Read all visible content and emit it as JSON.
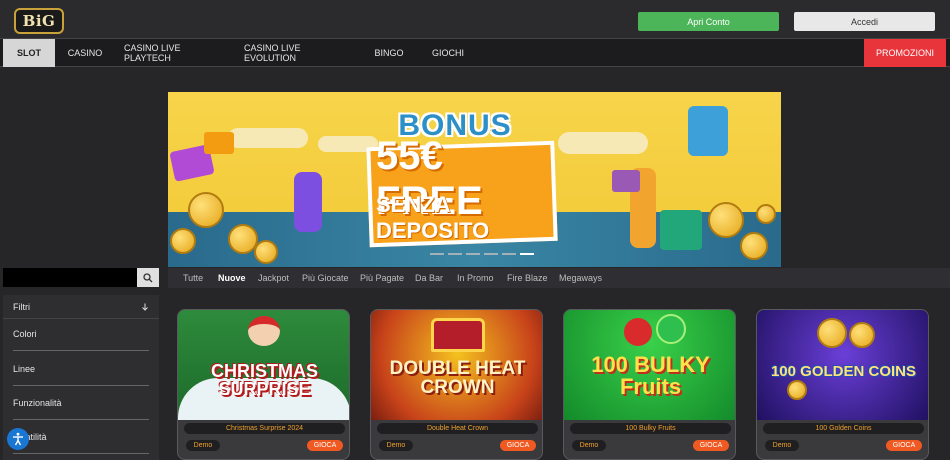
{
  "header": {
    "logo_text": "BiG",
    "open_account_label": "Apri Conto",
    "login_label": "Accedi"
  },
  "nav": {
    "items": [
      {
        "label": "SLOT"
      },
      {
        "label": "CASINO"
      },
      {
        "label": "CASINO LIVE PLAYTECH"
      },
      {
        "label": "CASINO LIVE EVOLUTION"
      },
      {
        "label": "BINGO"
      },
      {
        "label": "GIOCHI"
      }
    ],
    "promo_label": "PROMOZIONI"
  },
  "banner": {
    "headline": "BONUS",
    "amount": "55€ FREE",
    "subline": "SENZA DEPOSITO",
    "slides_total": 6,
    "active_slide": 6
  },
  "search": {
    "icon": "search-icon",
    "value": ""
  },
  "tabs": [
    {
      "label": "Tutte"
    },
    {
      "label": "Nuove"
    },
    {
      "label": "Jackpot"
    },
    {
      "label": "Più Giocate"
    },
    {
      "label": "Più Pagate"
    },
    {
      "label": "Da Bar"
    },
    {
      "label": "In Promo"
    },
    {
      "label": "Fire Blaze"
    },
    {
      "label": "Megaways"
    }
  ],
  "filters": {
    "title": "Filtri",
    "items": [
      {
        "label": "Colori"
      },
      {
        "label": "Linee"
      },
      {
        "label": "Funzionalità"
      },
      {
        "label": "Volatilità"
      }
    ]
  },
  "games": [
    {
      "title_art": "CHRISTMAS SURPRISE",
      "name": "Christmas Surprise 2024",
      "demo": "Demo",
      "play": "GIOCA"
    },
    {
      "title_art": "DOUBLE HEAT CROWN",
      "name": "Double Heat Crown",
      "demo": "Demo",
      "play": "GIOCA"
    },
    {
      "title_art": "100 BULKY Fruits",
      "name": "100 Bulky Fruits",
      "demo": "Demo",
      "play": "GIOCA"
    },
    {
      "title_art": "100 GOLDEN COINS",
      "name": "100 Golden Coins",
      "demo": "Demo",
      "play": "GIOCA"
    }
  ],
  "colors": {
    "green": "#4cb559",
    "promo_red": "#e8353b",
    "play_orange": "#f05a22",
    "banner_yellow": "#f4cf3f"
  }
}
